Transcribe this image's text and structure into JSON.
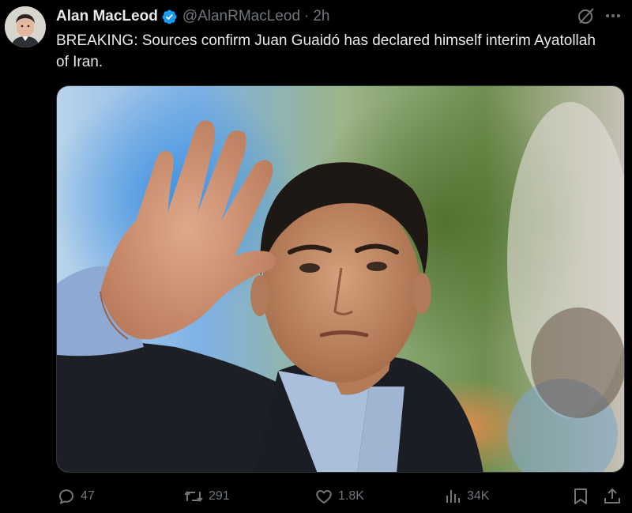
{
  "author": {
    "display_name": "Alan MacLeod",
    "handle": "@AlanRMacLeod",
    "separator": "·",
    "time": "2h",
    "avatar_icon": "profile-avatar",
    "verified_icon": "verified-badge-icon",
    "verified_color": "#1d9bf0"
  },
  "tweet": {
    "text": "BREAKING: Sources confirm Juan Guaidó has declared himself interim Ayatollah of Iran."
  },
  "header_icons": {
    "grok": "grok-icon",
    "more": "more-options-icon"
  },
  "media": {
    "type": "photo",
    "icon": "photo-of-man-waving"
  },
  "actions": {
    "replies": "47",
    "retweets": "291",
    "likes": "1.8K",
    "views": "34K",
    "reply_icon": "reply-icon",
    "retweet_icon": "retweet-icon",
    "like_icon": "heart-icon",
    "views_icon": "views-chart-icon",
    "bookmark_icon": "bookmark-icon",
    "share_icon": "share-icon"
  },
  "colors": {
    "background": "#000000",
    "text_primary": "#e7e9ea",
    "text_secondary": "#71767b",
    "accent": "#1d9bf0"
  }
}
